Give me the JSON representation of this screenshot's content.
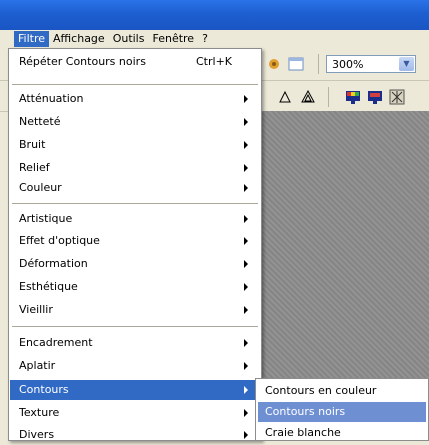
{
  "menubar": {
    "items": [
      "Filtre",
      "Affichage",
      "Outils",
      "Fenêtre",
      "?"
    ]
  },
  "toolbar": {
    "zoom_value": "300%"
  },
  "filter_menu": {
    "repeat": {
      "label": "Répéter Contours noirs",
      "shortcut": "Ctrl+K"
    },
    "items": [
      "Atténuation",
      "Netteté",
      "Bruit",
      "Relief",
      "Couleur",
      "Artistique",
      "Effet d'optique",
      "Déformation",
      "Esthétique",
      "Vieillir",
      "Encadrement",
      "Aplatir",
      "Contours",
      "Texture",
      "Divers"
    ],
    "highlighted": "Contours"
  },
  "contours_submenu": {
    "items": [
      "Contours en couleur",
      "Contours noirs",
      "Craie blanche"
    ],
    "highlighted": "Contours noirs"
  },
  "colors": {
    "highlight": "#316ac5",
    "submenu_highlight": "#6f8fd3",
    "menubar_bg": "#ece9d8",
    "titlebar": "#1d5fd1"
  }
}
